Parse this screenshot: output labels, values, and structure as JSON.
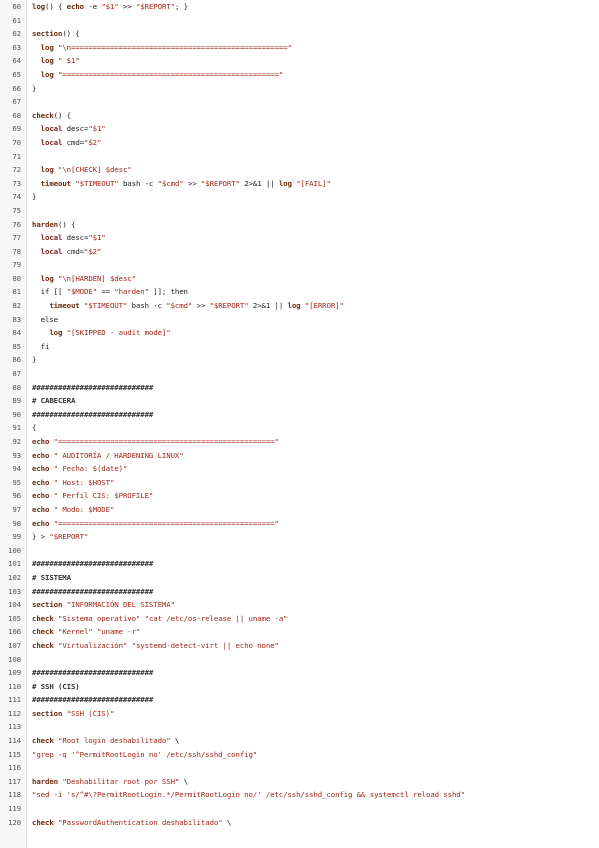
{
  "editor": {
    "lines": [
      {
        "n": "60",
        "t": "log() { echo -e \"$1\" >> \"$REPORT\"; }"
      },
      {
        "n": "61",
        "t": ""
      },
      {
        "n": "62",
        "t": "section() {"
      },
      {
        "n": "63",
        "t": "  log \"\\n==================================================\""
      },
      {
        "n": "64",
        "t": "  log \" $1\""
      },
      {
        "n": "65",
        "t": "  log \"==================================================\""
      },
      {
        "n": "66",
        "t": "}"
      },
      {
        "n": "67",
        "t": ""
      },
      {
        "n": "68",
        "t": "check() {"
      },
      {
        "n": "69",
        "t": "  local desc=\"$1\""
      },
      {
        "n": "70",
        "t": "  local cmd=\"$2\""
      },
      {
        "n": "71",
        "t": ""
      },
      {
        "n": "72",
        "t": "  log \"\\n[CHECK] $desc\""
      },
      {
        "n": "73",
        "t": "  timeout \"$TIMEOUT\" bash -c \"$cmd\" >> \"$REPORT\" 2>&1 || log \"[FAIL]\""
      },
      {
        "n": "74",
        "t": "}"
      },
      {
        "n": "75",
        "t": ""
      },
      {
        "n": "76",
        "t": "harden() {"
      },
      {
        "n": "77",
        "t": "  local desc=\"$1\""
      },
      {
        "n": "78",
        "t": "  local cmd=\"$2\""
      },
      {
        "n": "79",
        "t": ""
      },
      {
        "n": "80",
        "t": "  log \"\\n[HARDEN] $desc\""
      },
      {
        "n": "81",
        "t": "  if [[ \"$MODE\" == \"harden\" ]]; then"
      },
      {
        "n": "82",
        "t": "    timeout \"$TIMEOUT\" bash -c \"$cmd\" >> \"$REPORT\" 2>&1 || log \"[ERROR]\""
      },
      {
        "n": "83",
        "t": "  else"
      },
      {
        "n": "84",
        "t": "    log \"[SKIPPED - audit mode]\""
      },
      {
        "n": "85",
        "t": "  fi"
      },
      {
        "n": "86",
        "t": "}"
      },
      {
        "n": "87",
        "t": ""
      },
      {
        "n": "88",
        "t": "############################"
      },
      {
        "n": "89",
        "t": "# CABECERA"
      },
      {
        "n": "90",
        "t": "############################"
      },
      {
        "n": "91",
        "t": "{"
      },
      {
        "n": "92",
        "t": "echo \"==================================================\""
      },
      {
        "n": "93",
        "t": "echo \" AUDITORÍA / HARDENING LINUX\""
      },
      {
        "n": "94",
        "t": "echo \" Fecha: $(date)\""
      },
      {
        "n": "95",
        "t": "echo \" Host: $HOST\""
      },
      {
        "n": "96",
        "t": "echo \" Perfil CIS: $PROFILE\""
      },
      {
        "n": "97",
        "t": "echo \" Modo: $MODE\""
      },
      {
        "n": "98",
        "t": "echo \"==================================================\""
      },
      {
        "n": "99",
        "t": "} > \"$REPORT\""
      },
      {
        "n": "100",
        "t": ""
      },
      {
        "n": "101",
        "t": "############################"
      },
      {
        "n": "102",
        "t": "# SISTEMA"
      },
      {
        "n": "103",
        "t": "############################"
      },
      {
        "n": "104",
        "t": "section \"INFORMACIÓN DEL SISTEMA\""
      },
      {
        "n": "105",
        "t": "check \"Sistema operativo\" \"cat /etc/os-release || uname -a\""
      },
      {
        "n": "106",
        "t": "check \"Kernel\" \"uname -r\""
      },
      {
        "n": "107",
        "t": "check \"Virtualización\" \"systemd-detect-virt || echo none\""
      },
      {
        "n": "108",
        "t": ""
      },
      {
        "n": "109",
        "t": "############################"
      },
      {
        "n": "110",
        "t": "# SSH (CIS)"
      },
      {
        "n": "111",
        "t": "############################"
      },
      {
        "n": "112",
        "t": "section \"SSH (CIS)\""
      },
      {
        "n": "113",
        "t": ""
      },
      {
        "n": "114",
        "t": "check \"Root login deshabilitado\" \\"
      },
      {
        "n": "115",
        "t": "\"grep -q '^PermitRootLogin no' /etc/ssh/sshd_config\""
      },
      {
        "n": "116",
        "t": ""
      },
      {
        "n": "117",
        "t": "harden \"Deshabilitar root por SSH\" \\"
      },
      {
        "n": "118",
        "t": "\"sed -i 's/^#\\?PermitRootLogin.*/PermitRootLogin no/' /etc/ssh/sshd_config && systemctl reload sshd\""
      },
      {
        "n": "119",
        "t": ""
      },
      {
        "n": "120",
        "t": "check \"PasswordAuthentication deshabilitado\" \\"
      }
    ]
  }
}
